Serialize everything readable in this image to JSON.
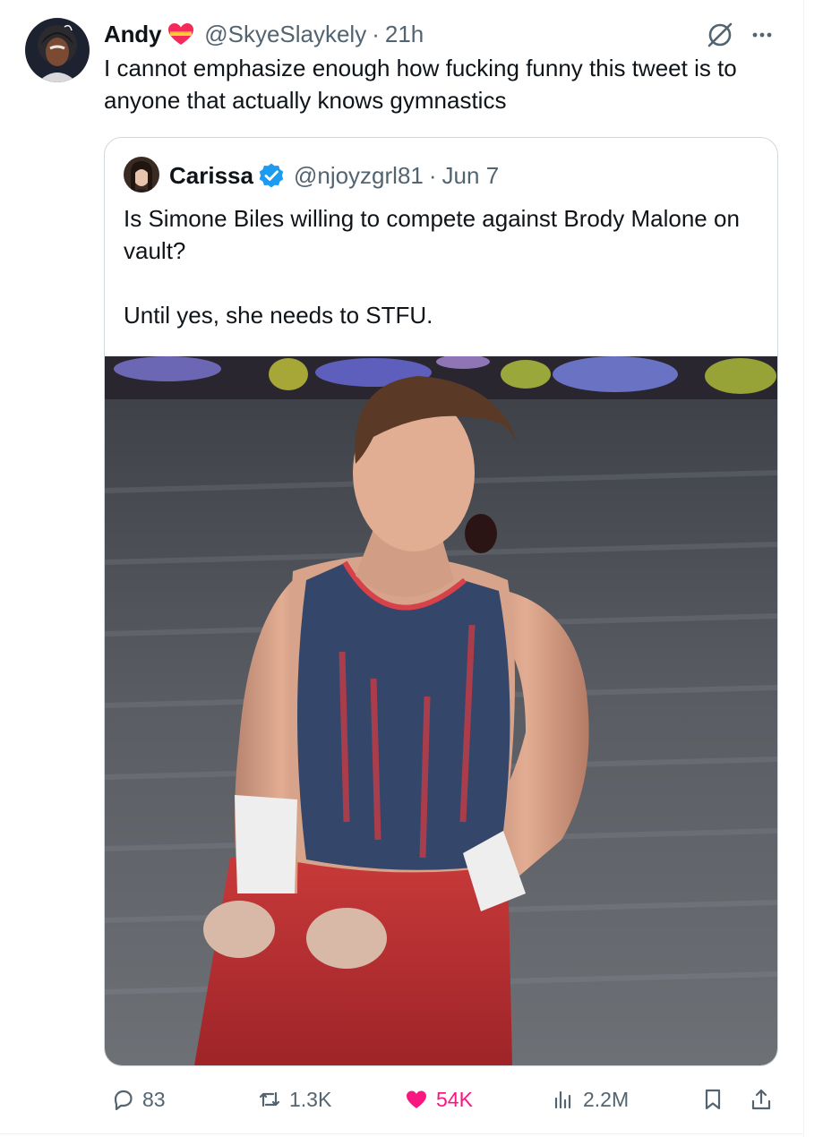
{
  "tweet": {
    "author": {
      "display_name": "Andy",
      "handle": "@SkyeSlaykely",
      "avatar_icon": "user-avatar",
      "badge_icon": "heart-with-ribbon-icon"
    },
    "separator": "·",
    "timestamp": "21h",
    "text": "I cannot emphasize enough how fucking funny this tweet is to anyone that actually knows gymnastics",
    "quoted": {
      "author": {
        "display_name": "Carissa",
        "handle": "@njoyzgrl81",
        "verified": true,
        "avatar_icon": "user-avatar"
      },
      "separator": "·",
      "timestamp": "Jun 7",
      "text_line1": "Is Simone Biles willing to compete against Brody Malone on vault?",
      "text_line2": "Until yes, she needs to STFU.",
      "media": "photo"
    },
    "actions": {
      "replies": "83",
      "reposts": "1.3K",
      "likes": "54K",
      "views": "2.2M"
    }
  },
  "colors": {
    "text": "#0f1419",
    "secondary": "#536471",
    "like": "#f91880",
    "verified": "#1d9bf0",
    "border": "#cfd9de"
  }
}
